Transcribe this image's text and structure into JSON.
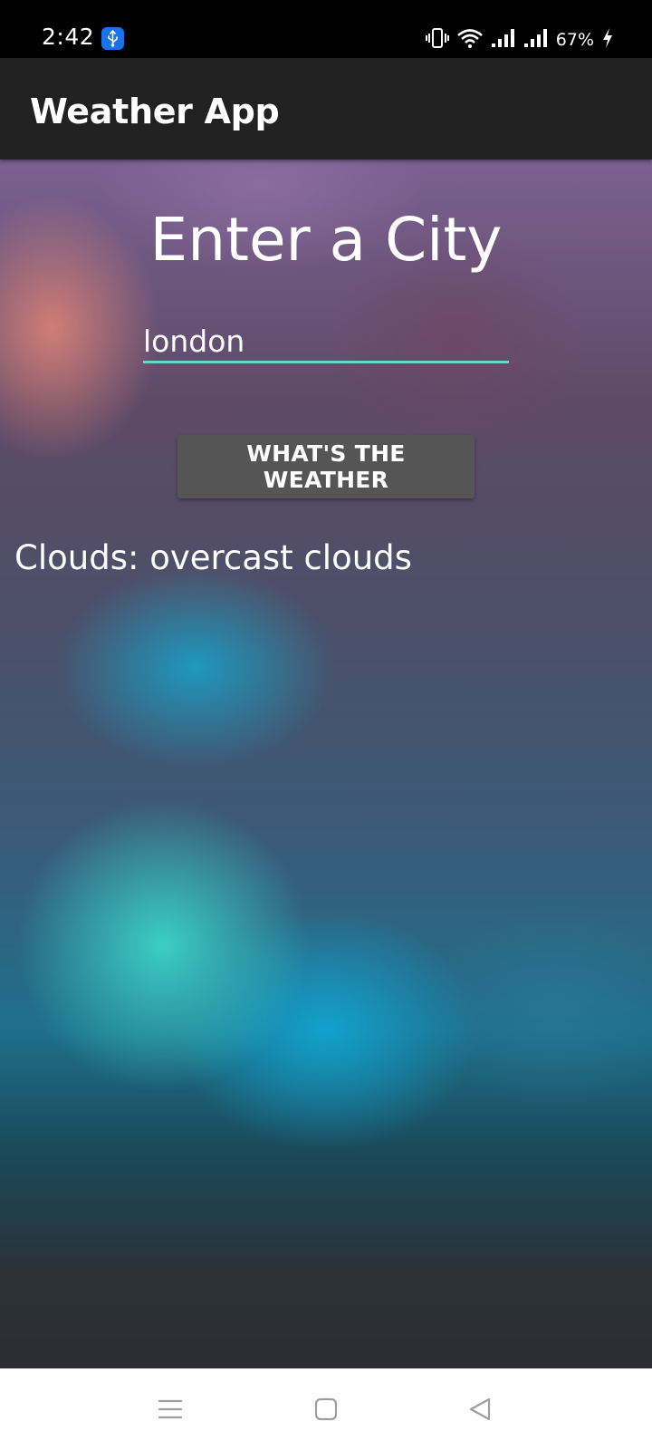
{
  "status_bar": {
    "time": "2:42",
    "battery": "67%",
    "icons": [
      "usb-icon",
      "vibrate-icon",
      "wifi-icon",
      "signal-icon",
      "signal-icon",
      "charging-icon"
    ]
  },
  "app_bar": {
    "title": "Weather App"
  },
  "main": {
    "heading": "Enter a City",
    "city_input": {
      "value": "london",
      "accent_color": "#80cbc4"
    },
    "button_label": "WHAT'S THE WEATHER",
    "result": "Clouds: overcast clouds"
  },
  "nav_bar": {
    "icons": [
      "menu-icon",
      "home-icon",
      "back-icon"
    ]
  }
}
